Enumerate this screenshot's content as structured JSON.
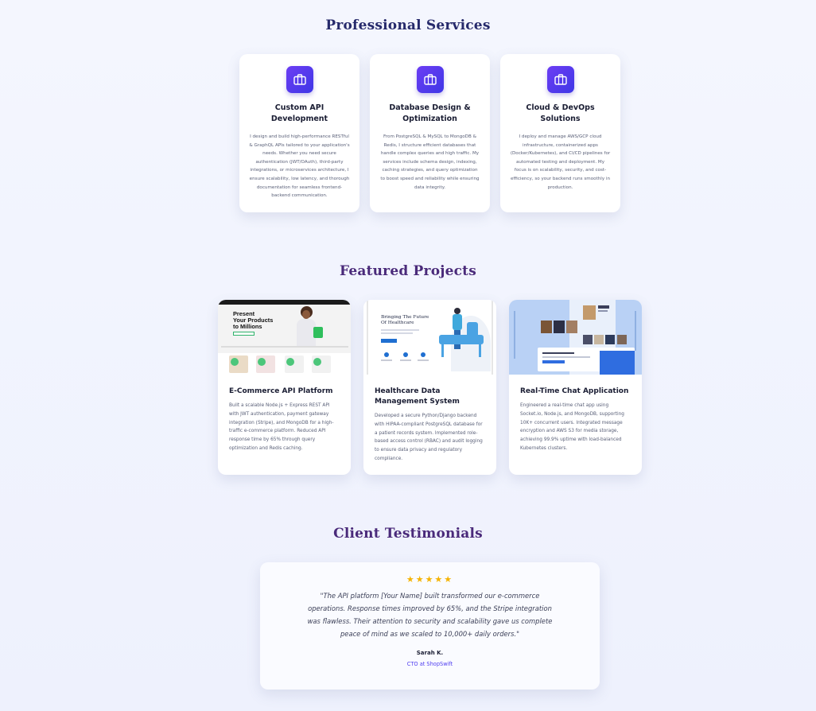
{
  "services": {
    "title": "Professional Services",
    "items": [
      {
        "title": "Custom API Development",
        "icon": "briefcase-icon",
        "description": "I design and build high-performance RESTful & GraphQL APIs tailored to your application's needs. Whether you need secure authentication (JWT/OAuth), third-party integrations, or microservices architecture, I ensure scalability, low latency, and thorough documentation for seamless frontend-backend communication."
      },
      {
        "title": "Database Design & Optimization",
        "icon": "briefcase-icon",
        "description": "From PostgreSQL & MySQL to MongoDB & Redis, I structure efficient databases that handle complex queries and high traffic. My services include schema design, indexing, caching strategies, and query optimization to boost speed and reliability while ensuring data integrity."
      },
      {
        "title": "Cloud & DevOps Solutions",
        "icon": "briefcase-icon",
        "description": "I deploy and manage AWS/GCP cloud infrastructure, containerized apps (Docker/Kubernetes), and CI/CD pipelines for automated testing and deployment. My focus is on scalability, security, and cost-efficiency, so your backend runs smoothly in production."
      }
    ]
  },
  "projects": {
    "title": "Featured Projects",
    "items": [
      {
        "title": "E-Commerce API Platform",
        "thumb_text": [
          "Present",
          "Your Products",
          "to Millions"
        ],
        "description": "Built a scalable Node.js + Express REST API with JWT authentication, payment gateway integration (Stripe), and MongoDB for a high-traffic e-commerce platform. Reduced API response time by 65% through query optimization and Redis caching."
      },
      {
        "title": "Healthcare Data Management System",
        "thumb_text": [
          "Bringing The Future",
          "Of Healthcare"
        ],
        "description": "Developed a secure Python/Django backend with HIPAA-compliant PostgreSQL database for a patient records system. Implemented role-based access control (RBAC) and audit logging to ensure data privacy and regulatory compliance."
      },
      {
        "title": "Real-Time Chat Application",
        "thumb_text": [],
        "description": "Engineered a real-time chat app using Socket.io, Node.js, and MongoDB, supporting 10K+ concurrent users. Integrated message encryption and AWS S3 for media storage, achieving 99.9% uptime with load-balanced Kubernetes clusters."
      }
    ]
  },
  "testimonials": {
    "title": "Client Testimonials",
    "rating": 5,
    "stars": "★★★★★",
    "quote": "\"The API platform [Your Name] built transformed our e-commerce operations. Response times improved by 65%, and the Stripe integration was flawless. Their attention to security and scalability gave us complete peace of mind as we scaled to 10,000+ daily orders.\"",
    "author": "Sarah K.",
    "role": "CTO at ShopSwift"
  },
  "colors": {
    "accent_start": "#6c3df4",
    "accent_end": "#3f37e6",
    "heading": "#262a6b",
    "star": "#f5b301",
    "link": "#4f3df0"
  }
}
